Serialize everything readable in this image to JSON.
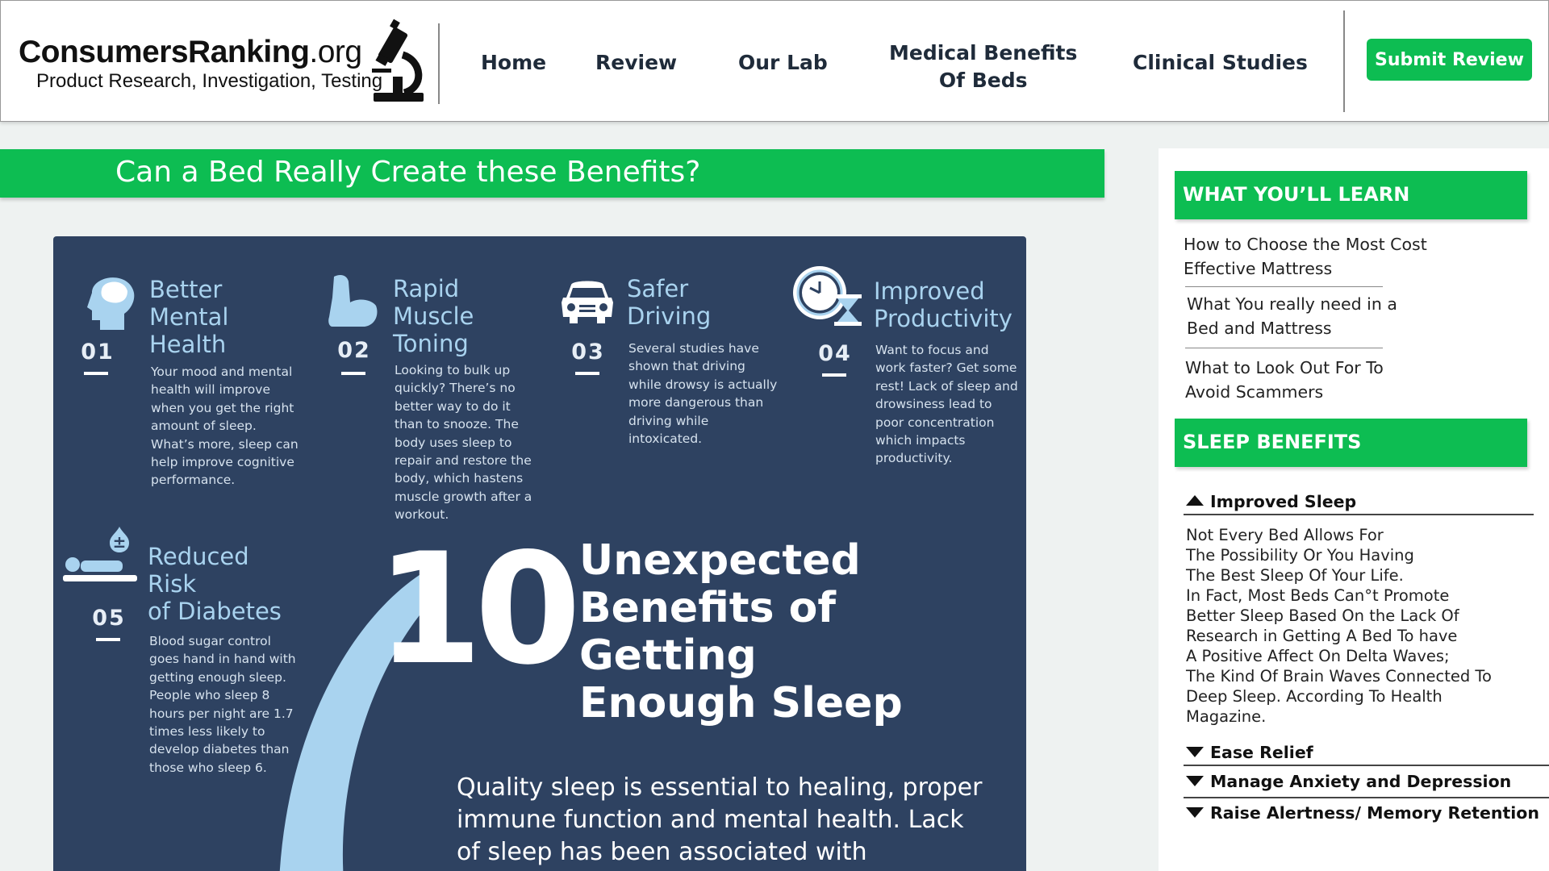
{
  "header": {
    "logo": {
      "brand_main": "ConsumersRanking",
      "brand_tld": ".org",
      "tagline": "Product Research, Investigation, Testing"
    },
    "nav": [
      {
        "label": "Home"
      },
      {
        "label": "Review"
      },
      {
        "label": "Our Lab"
      },
      {
        "label": "Medical Benefits\nOf Beds"
      },
      {
        "label": "Clinical Studies"
      }
    ],
    "submit_label": "Submit Review"
  },
  "hero": {
    "title": "Can a Bed Really Create these Benefits?"
  },
  "infographic": {
    "colors": {
      "background": "#2e4261",
      "accent": "#a9d3ef"
    },
    "benefits": [
      {
        "num": "01",
        "title": "Better\nMental\nHealth",
        "icon": "brain-head-icon",
        "desc": "Your mood and mental\nhealth will improve\nwhen you get the right\namount of sleep.\nWhat’s more, sleep can\nhelp improve cognitive\nperformance."
      },
      {
        "num": "02",
        "title": "Rapid\nMuscle\nToning",
        "icon": "flexed-arm-icon",
        "desc": "Looking to bulk up\nquickly? There’s no\nbetter way to do it\nthan to snooze. The\nbody uses sleep to\nrepair and restore the\nbody, which hastens\nmuscle growth after a\nworkout."
      },
      {
        "num": "03",
        "title": "Safer\nDriving",
        "icon": "car-icon",
        "desc": "Several studies have\nshown that driving\nwhile drowsy is actually\nmore dangerous than\ndriving while\nintoxicated."
      },
      {
        "num": "04",
        "title": "Improved\nProductivity",
        "icon": "clock-hourglass-icon",
        "desc": "Want to focus and\nwork faster? Get some\nrest! Lack of sleep and\ndrowsiness lead to\npoor concentration\nwhich impacts\nproductivity."
      },
      {
        "num": "05",
        "title": "Reduced\nRisk\nof Diabetes",
        "icon": "sleeping-person-icon",
        "desc": "Blood sugar control\ngoes hand in hand with\ngetting enough sleep.\nPeople who sleep 8\nhours per night are 1.7\ntimes less likely to\ndevelop diabetes than\nthose who sleep 6."
      }
    ],
    "big_number": "10",
    "big_title": "Unexpected\nBenefits of Getting\nEnough Sleep",
    "quote": "Quality sleep is essential to healing, proper immune function and mental health. Lack of sleep has been associated with depression,"
  },
  "sidebar": {
    "learn_heading": "WHAT YOU’LL LEARN",
    "learn_items": [
      "How to Choose the Most Cost\nEffective Mattress",
      "What You really need in a\nBed and Mattress",
      "What to Look Out For To\nAvoid Scammers"
    ],
    "benefits_heading": "SLEEP BENEFITS",
    "accordion": [
      {
        "label": "Improved Sleep",
        "expanded": true
      },
      {
        "label": "Ease Relief",
        "expanded": false
      },
      {
        "label": "Manage Anxiety and Depression",
        "expanded": false
      },
      {
        "label": "Raise Alertness/ Memory Retention",
        "expanded": false
      }
    ],
    "improved_sleep_body": "Not Every Bed Allows For\nThe Possibility Or You Having\nThe Best Sleep Of Your Life.\nIn Fact, Most Beds Can°t Promote\nBetter Sleep Based On the Lack Of\nResearch in Getting A Bed To have\nA Positive Affect On Delta Waves;\nThe Kind Of Brain Waves Connected To\nDeep Sleep. According To Health\nMagazine."
  }
}
